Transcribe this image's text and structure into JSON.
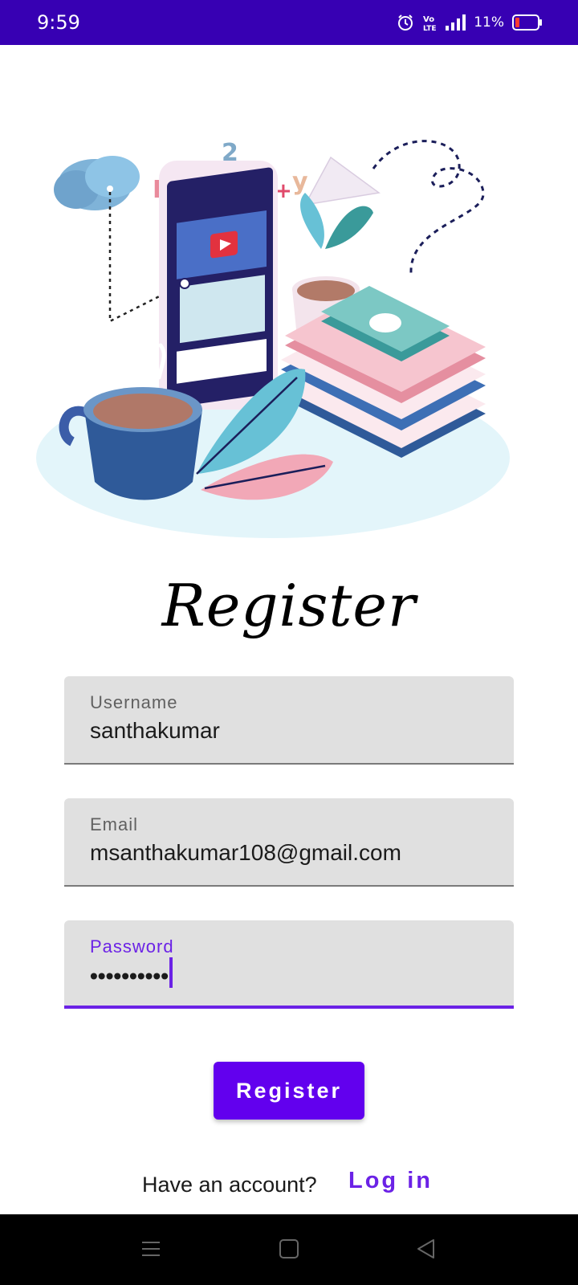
{
  "status_bar": {
    "time": "9:59",
    "battery_percent": "11%",
    "icons": [
      "alarm-icon",
      "volte-icon",
      "signal-icon",
      "battery-icon"
    ]
  },
  "title": "Register",
  "form": {
    "username": {
      "label": "Username",
      "value": "santhakumar"
    },
    "email": {
      "label": "Email",
      "value": "msanthakumar108@gmail.com"
    },
    "password": {
      "label": "Password",
      "masked_value": "••••••••••"
    }
  },
  "register_button": "Register",
  "footer": {
    "prompt": "Have an account?",
    "login_link": "Log in"
  },
  "nav_bar": {
    "icons": [
      "menu-icon",
      "home-icon",
      "back-icon"
    ]
  },
  "colors": {
    "status_bar": "#3700b3",
    "accent": "#6200ee",
    "field_bg": "#e0e0e0"
  }
}
